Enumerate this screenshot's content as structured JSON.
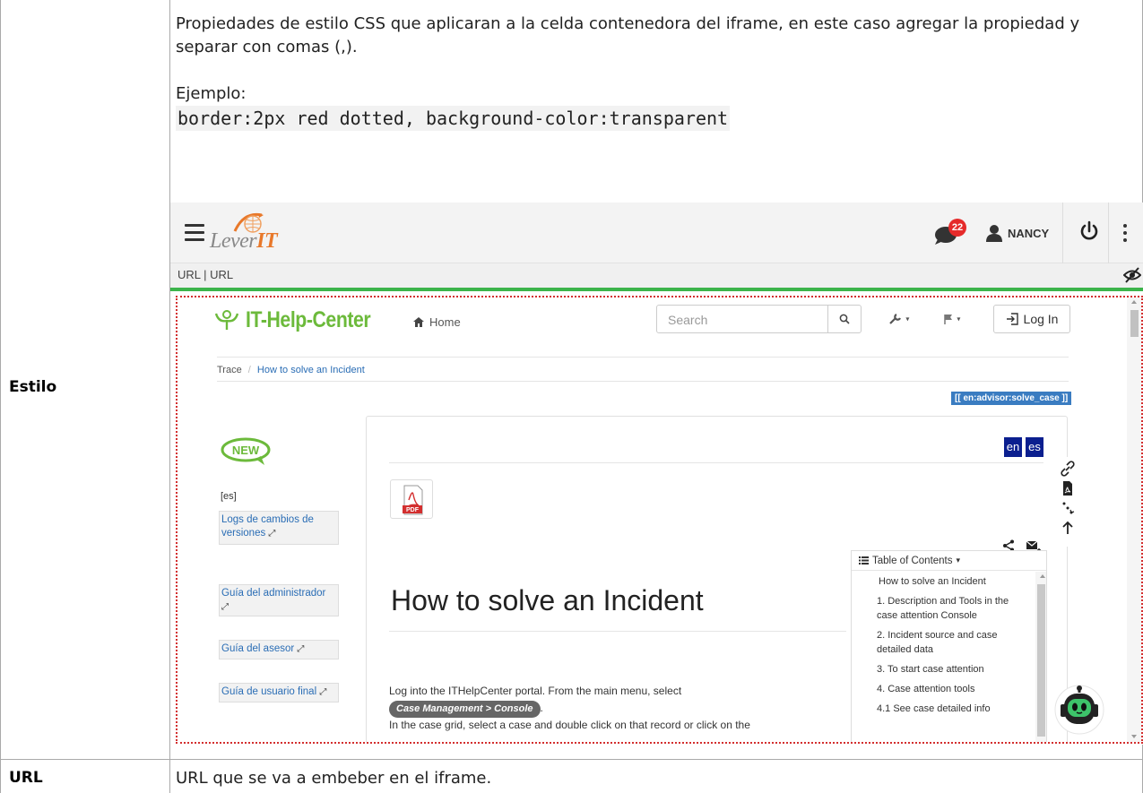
{
  "doc": {
    "row_estilo_label": "Estilo",
    "row_url_label": "URL",
    "desc_line1": "Propiedades de estilo CSS que aplicaran a la celda contenedora del iframe, en este caso agregar la propiedad y separar con comas (,).",
    "ejemplo_label": "Ejemplo:",
    "ejemplo_code": "border:2px red dotted, background-color:transparent",
    "url_desc": "URL que se va a embeber en el iframe."
  },
  "app": {
    "logo_text_a": "Lever",
    "logo_text_b": "IT",
    "chat_badge_count": "22",
    "user_name": "NANCY",
    "url_tabs": "URL | URL",
    "icons": {
      "menu": "hamburger-icon",
      "chat": "chat-icon",
      "user": "user-icon",
      "power": "power-icon",
      "more": "kebab-icon",
      "visibility": "eye-off-icon"
    },
    "colors": {
      "accent_green": "#3cb44b",
      "badge_red": "#e52a2a",
      "iframe_border": "#d32f2f"
    }
  },
  "helpcenter": {
    "logo_text": "IT-Help-Center",
    "home_label": "Home",
    "search_placeholder": "Search",
    "login_label": "Log In",
    "breadcrumb_root": "Trace",
    "breadcrumb_sep": "/",
    "breadcrumb_current": "How to solve an Incident",
    "advisor_tag": "[[ en:advisor:solve_case ]]",
    "new_badge": "NEW",
    "lang_marker": "[es]",
    "sidebar_links": [
      "Logs de cambios de versiones",
      "Guía del administrador",
      "Guía del asesor",
      "Guía de usuario final"
    ],
    "lang_en": "en",
    "lang_es": "es",
    "pdf_label": "PDF",
    "title": "How to solve an Incident",
    "body_line1": "Log into the ITHelpCenter portal. From the main menu, select",
    "body_pill": "Case Management > Console",
    "body_pill_after": ".",
    "body_line2": "In the case grid, select a case and double click on that record or click on the",
    "toc_title": "Table of Contents",
    "toc_items": [
      "How to solve an Incident",
      "1. Description and Tools in the case attention Console",
      "2. Incident source and case detailed data",
      "3. To start case attention",
      "4. Case attention tools",
      "4.1 See case detailed info"
    ]
  }
}
